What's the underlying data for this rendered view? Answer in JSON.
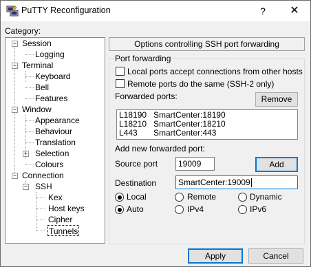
{
  "window": {
    "title": "PuTTY Reconfiguration",
    "help_button": "?",
    "close_button": "✕"
  },
  "sidebar": {
    "category_label": "Category:",
    "tree": [
      {
        "label": "Session",
        "expander": "−"
      },
      {
        "label": "Logging"
      },
      {
        "label": "Terminal",
        "expander": "−"
      },
      {
        "label": "Keyboard"
      },
      {
        "label": "Bell"
      },
      {
        "label": "Features"
      },
      {
        "label": "Window",
        "expander": "−"
      },
      {
        "label": "Appearance"
      },
      {
        "label": "Behaviour"
      },
      {
        "label": "Translation"
      },
      {
        "label": "Selection",
        "expander": "+"
      },
      {
        "label": "Colours"
      },
      {
        "label": "Connection",
        "expander": "−"
      },
      {
        "label": "SSH",
        "expander": "−"
      },
      {
        "label": "Kex"
      },
      {
        "label": "Host keys"
      },
      {
        "label": "Cipher"
      },
      {
        "label": "Tunnels",
        "selected": true
      }
    ]
  },
  "panel": {
    "header": "Options controlling SSH port forwarding",
    "group_title": "Port forwarding",
    "local_ports_checkbox": {
      "label": "Local ports accept connections from other hosts",
      "checked": false
    },
    "remote_ports_checkbox": {
      "label": "Remote ports do the same (SSH-2 only)",
      "checked": false
    },
    "forwarded_ports_label": "Forwarded ports:",
    "remove_button": "Remove",
    "forwarded_ports": [
      {
        "port": "L18190",
        "destination": "SmartCenter:18190"
      },
      {
        "port": "L18210",
        "destination": "SmartCenter:18210"
      },
      {
        "port": "L443",
        "destination": "SmartCenter:443"
      }
    ],
    "add_new_label": "Add new forwarded port:",
    "source_port_label": "Source port",
    "source_port_value": "19009",
    "add_button": "Add",
    "destination_label": "Destination",
    "destination_value": "SmartCenter:19009",
    "direction_options": [
      {
        "label": "Local",
        "checked": true
      },
      {
        "label": "Remote",
        "checked": false
      },
      {
        "label": "Dynamic",
        "checked": false
      }
    ],
    "ip_options": [
      {
        "label": "Auto",
        "checked": true
      },
      {
        "label": "IPv4",
        "checked": false
      },
      {
        "label": "IPv6",
        "checked": false
      }
    ]
  },
  "footer": {
    "apply_button": "Apply",
    "cancel_button": "Cancel"
  }
}
